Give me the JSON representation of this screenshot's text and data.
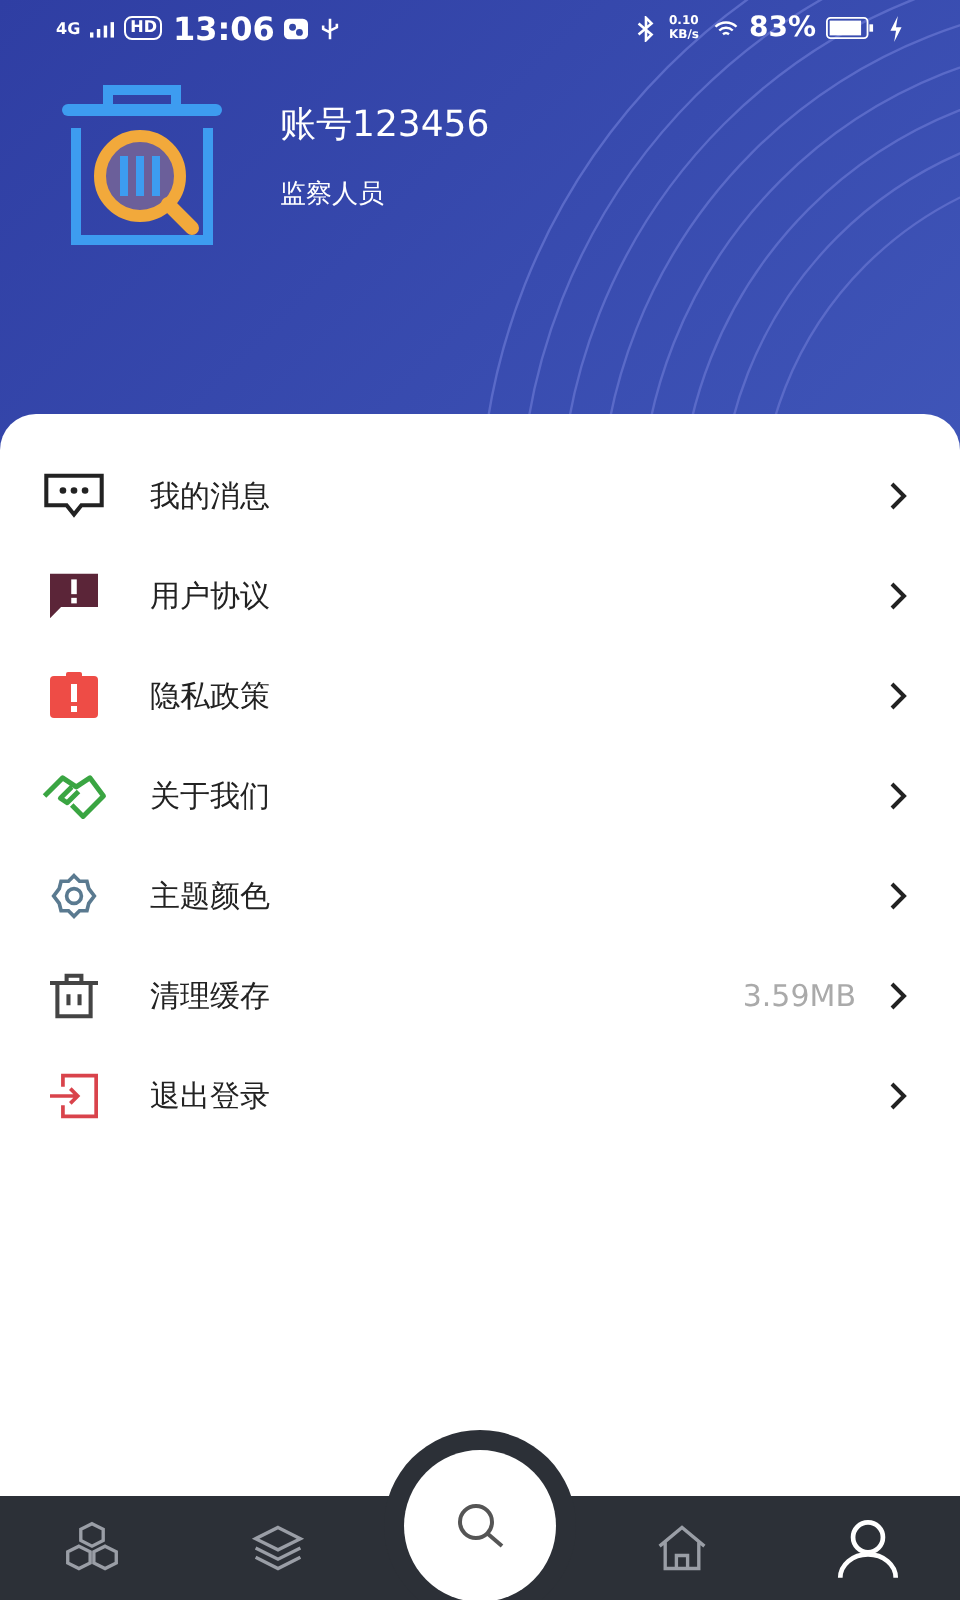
{
  "status_bar": {
    "network": "4G",
    "hd": "HD",
    "time": "13:06",
    "speed": "0.10 KB/s",
    "battery": "83%"
  },
  "profile": {
    "account": "账号123456",
    "role": "监察人员"
  },
  "menu": [
    {
      "kind": "message",
      "label": "我的消息"
    },
    {
      "kind": "agreement",
      "label": "用户协议"
    },
    {
      "kind": "privacy",
      "label": "隐私政策"
    },
    {
      "kind": "about",
      "label": "关于我们"
    },
    {
      "kind": "theme",
      "label": "主题颜色"
    },
    {
      "kind": "cache",
      "label": "清理缓存",
      "value": "3.59MB"
    },
    {
      "kind": "logout",
      "label": "退出登录"
    }
  ],
  "bottom_nav": [
    {
      "kind": "cubes",
      "selected": false
    },
    {
      "kind": "layers",
      "selected": false
    },
    {
      "kind": "search",
      "selected": false
    },
    {
      "kind": "home",
      "selected": false
    },
    {
      "kind": "user",
      "selected": true
    }
  ]
}
